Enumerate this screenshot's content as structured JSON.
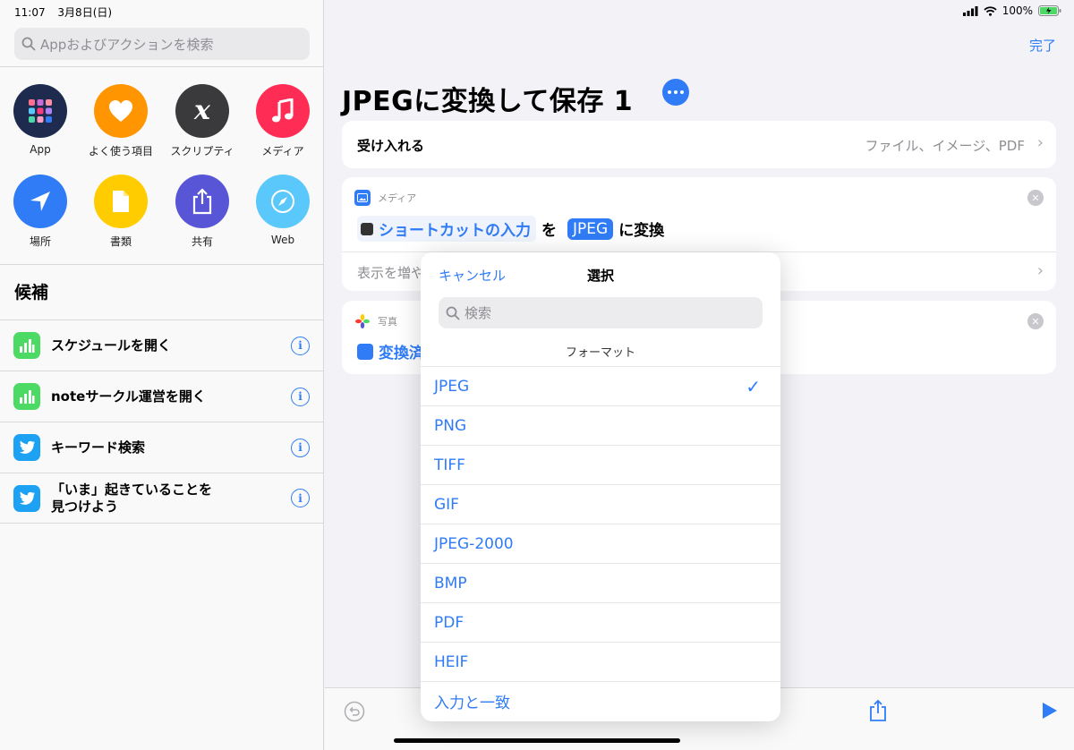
{
  "status": {
    "time": "11:07",
    "date": "3月8日(日)",
    "battery": "100%"
  },
  "sidebar": {
    "search_placeholder": "Appおよびアクションを検索",
    "categories": [
      {
        "label": "App",
        "icon": "app-grid-icon",
        "color": "#1e2a4e"
      },
      {
        "label": "よく使う項目",
        "icon": "heart-icon",
        "color": "#ff9500"
      },
      {
        "label": "スクリプティ",
        "icon": "script-x-icon",
        "color": "#3a3a3c"
      },
      {
        "label": "メディア",
        "icon": "music-note-icon",
        "color": "#ff2d55"
      },
      {
        "label": "場所",
        "icon": "location-arrow-icon",
        "color": "#2f7cf6"
      },
      {
        "label": "書類",
        "icon": "document-icon",
        "color": "#ffcc00"
      },
      {
        "label": "共有",
        "icon": "share-icon",
        "color": "#5856d6"
      },
      {
        "label": "Web",
        "icon": "compass-icon",
        "color": "#5ac8fa"
      }
    ],
    "suggestions_title": "候補",
    "suggestions": [
      {
        "label": "スケジュールを開く",
        "icon": "shortcuts-chart-icon",
        "color": "#4cd964"
      },
      {
        "label": "noteサークル運営を開く",
        "icon": "shortcuts-chart-icon",
        "color": "#4cd964"
      },
      {
        "label": "キーワード検索",
        "icon": "twitter-bird-icon",
        "color": "#1da1f2"
      },
      {
        "label": "「いま」起きていることを\n見つけよう",
        "icon": "twitter-bird-icon",
        "color": "#1da1f2"
      }
    ]
  },
  "main": {
    "done_label": "完了",
    "title": "JPEGに変換して保存 1",
    "accept": {
      "label": "受け入れる",
      "value": "ファイル、イメージ、PDF"
    },
    "media_action": {
      "category": "メディア",
      "input_token": "ショートカットの入力",
      "word_wo": "を",
      "format_token": "JPEG",
      "word_convert": "に変換",
      "show_more": "表示を増や"
    },
    "photo_action": {
      "category": "写真",
      "token": "変換済"
    }
  },
  "popover": {
    "cancel_label": "キャンセル",
    "title": "選択",
    "search_placeholder": "検索",
    "section_title": "フォーマット",
    "options": [
      "JPEG",
      "PNG",
      "TIFF",
      "GIF",
      "JPEG-2000",
      "BMP",
      "PDF",
      "HEIF",
      "入力と一致"
    ],
    "selected": "JPEG"
  }
}
